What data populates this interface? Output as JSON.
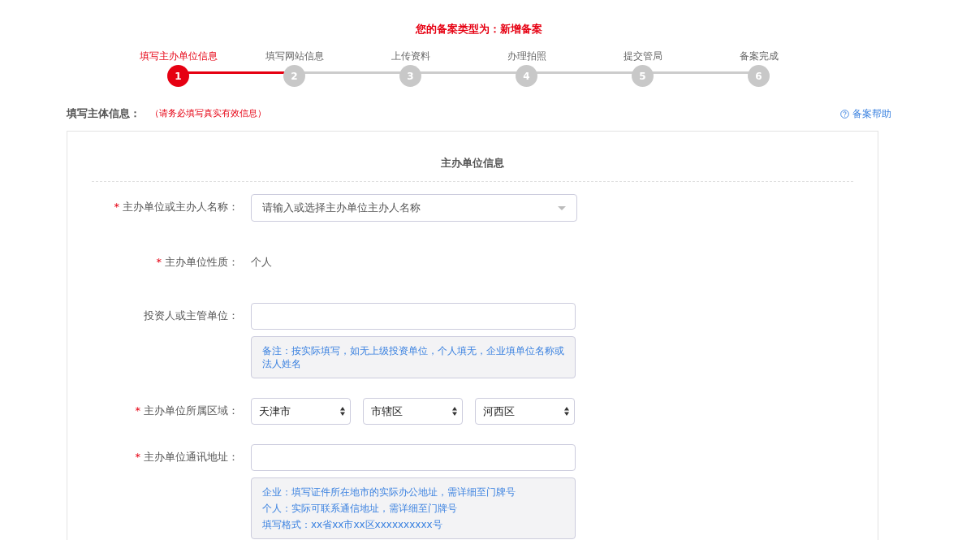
{
  "record_type": {
    "label": "您的备案类型为：",
    "value": "新增备案"
  },
  "steps": [
    {
      "label": "填写主办单位信息",
      "number": "1",
      "selected": true
    },
    {
      "label": "填写网站信息",
      "number": "2",
      "selected": false
    },
    {
      "label": "上传资料",
      "number": "3",
      "selected": false
    },
    {
      "label": "办理拍照",
      "number": "4",
      "selected": false
    },
    {
      "label": "提交管局",
      "number": "5",
      "selected": false
    },
    {
      "label": "备案完成",
      "number": "6",
      "selected": false
    }
  ],
  "section": {
    "title": "填写主体信息：",
    "notice": "（请务必填写真实有效信息）",
    "help_link": "备案帮助"
  },
  "card": {
    "title": "主办单位信息"
  },
  "rows": [
    {
      "kind": "combo",
      "label": "主办单位或主办人名称：",
      "required_mark": "*",
      "placeholder": "请输入或选择主办单位主办人名称"
    },
    {
      "kind": "text",
      "label": "主办单位性质：",
      "required_mark": "*",
      "value": "个人"
    },
    {
      "kind": "input",
      "label": "投资人或主管单位：",
      "notes": [
        "备注：按实际填写，如无上级投资单位，个人填无，企业填单位名称或法人姓名"
      ]
    },
    {
      "kind": "selects",
      "label": "主办单位所属区域：",
      "required_mark": "*",
      "options": [
        "天津市",
        "市辖区",
        "河西区"
      ]
    },
    {
      "kind": "input",
      "label": "主办单位通讯地址：",
      "required_mark": "*",
      "notes": [
        "企业：填写证件所在地市的实际办公地址，需详细至门牌号",
        "个人：实际可联系通信地址，需详细至门牌号",
        "填写格式：xx省xx市xx区xxxxxxxxxx号"
      ]
    }
  ]
}
